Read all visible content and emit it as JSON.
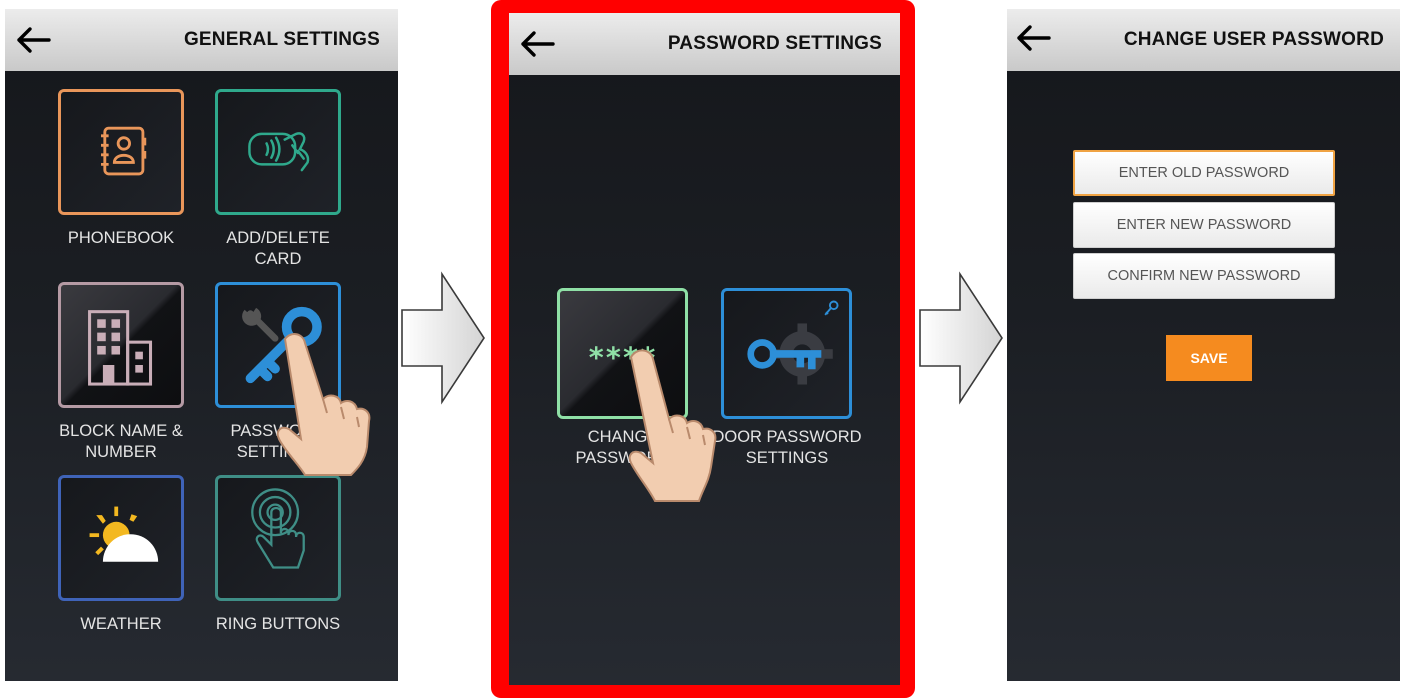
{
  "colors": {
    "phonebook": "#e9965a",
    "card": "#2fa98c",
    "block": "#b59aa4",
    "password": "#2d8fd8",
    "weather": "#3f63b8",
    "ring": "#3f8e86",
    "change": "#8fe0a6",
    "door": "#2d8fd8",
    "highlight": "#ff0000",
    "save": "#f58b1f"
  },
  "screen1": {
    "title": "GENERAL SETTINGS",
    "back_icon": "left-arrow-icon",
    "tiles": [
      {
        "label": "PHONEBOOK",
        "icon": "phonebook-icon"
      },
      {
        "label": "ADD/DELETE\nCARD",
        "icon": "contactless-card-icon"
      },
      {
        "label": "BLOCK NAME &\nNUMBER",
        "icon": "building-icon"
      },
      {
        "label": "PASSWORD\nSETTINGS",
        "icon": "wrench-key-icon"
      },
      {
        "label": "WEATHER",
        "icon": "sun-cloud-icon"
      },
      {
        "label": "RING BUTTONS",
        "icon": "finger-tap-icon"
      }
    ]
  },
  "screen2": {
    "title": "PASSWORD SETTINGS",
    "back_icon": "left-arrow-icon",
    "tiles": [
      {
        "label": "CHANGE\nPASSWORD",
        "icon": "password-asterisks-icon"
      },
      {
        "label": "DOOR PASSWORD\nSETTINGS",
        "icon": "key-gear-icon"
      }
    ]
  },
  "screen3": {
    "title": "CHANGE USER PASSWORD",
    "back_icon": "left-arrow-icon",
    "fields": [
      {
        "placeholder": "ENTER OLD PASSWORD"
      },
      {
        "placeholder": "ENTER NEW PASSWORD"
      },
      {
        "placeholder": "CONFIRM NEW PASSWORD"
      }
    ],
    "save_label": "SAVE"
  }
}
